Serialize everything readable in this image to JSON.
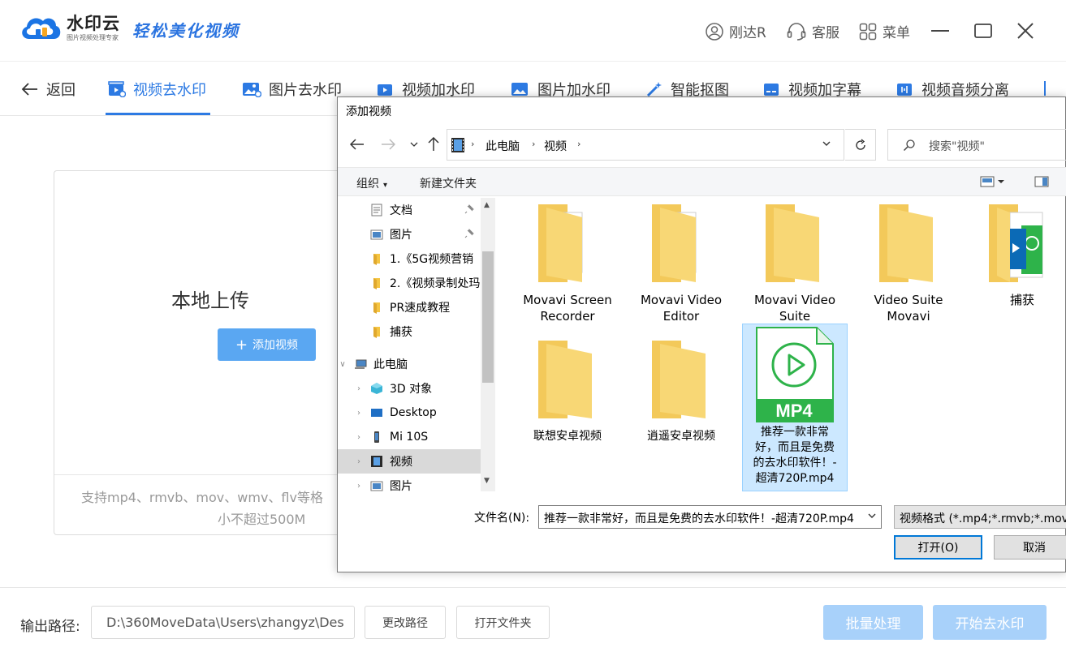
{
  "header": {
    "logo_name": "水印云",
    "logo_sub": "图片视频处理专家",
    "slogan": "轻松美化视频",
    "user": "刚达R",
    "service": "客服",
    "menu": "菜单"
  },
  "nav": {
    "back": "返回",
    "tabs": [
      {
        "label": "视频去水印",
        "active": true
      },
      {
        "label": "图片去水印"
      },
      {
        "label": "视频加水印"
      },
      {
        "label": "图片加水印"
      },
      {
        "label": "智能抠图"
      },
      {
        "label": "视频加字幕"
      },
      {
        "label": "视频音频分离"
      }
    ]
  },
  "upload": {
    "title": "本地上传",
    "add_button": "添加视频",
    "hint_line1": "支持mp4、rmvb、mov、wmv、flv等格",
    "hint_line2": "小不超过500M"
  },
  "footer": {
    "output_label": "输出路径:",
    "output_path": "D:\\360MoveData\\Users\\zhangyz\\Des",
    "change_path": "更改路径",
    "open_folder": "打开文件夹",
    "batch": "批量处理",
    "start": "开始去水印"
  },
  "dialog": {
    "title": "添加视频",
    "breadcrumb": [
      "此电脑",
      "视频"
    ],
    "search_placeholder": "搜索\"视频\"",
    "toolbar": {
      "organize": "组织",
      "new_folder": "新建文件夹"
    },
    "nav_items": [
      {
        "label": "文档",
        "icon": "document-icon",
        "pinned": true
      },
      {
        "label": "图片",
        "icon": "pictures-icon",
        "pinned": true
      },
      {
        "label": "1.《5G视频营销",
        "icon": "folder-icon"
      },
      {
        "label": "2.《视频录制处玛",
        "icon": "folder-icon"
      },
      {
        "label": "PR速成教程",
        "icon": "folder-icon"
      },
      {
        "label": "捕获",
        "icon": "folder-icon"
      },
      {
        "label": "此电脑",
        "icon": "computer-icon",
        "expanded": true
      },
      {
        "label": "3D 对象",
        "icon": "3d-objects-icon"
      },
      {
        "label": "Desktop",
        "icon": "desktop-icon"
      },
      {
        "label": "Mi 10S",
        "icon": "phone-icon"
      },
      {
        "label": "视频",
        "icon": "video-folder-icon",
        "selected": true
      },
      {
        "label": "图片",
        "icon": "pictures-icon"
      }
    ],
    "files": [
      {
        "name": "Movavi Screen\nRecorder",
        "type": "folder-docs"
      },
      {
        "name": "Movavi Video\nEditor",
        "type": "folder-docs"
      },
      {
        "name": "Movavi Video\nSuite",
        "type": "folder"
      },
      {
        "name": "Video Suite\nMovavi",
        "type": "folder"
      },
      {
        "name": "捕获",
        "type": "folder-media"
      },
      {
        "name": "联想安卓视频",
        "type": "folder"
      },
      {
        "name": "逍遥安卓视频",
        "type": "folder"
      },
      {
        "name": "推荐一款非常\n好，而且是免费\n的去水印软件！-\n超清720P.mp4",
        "type": "mp4",
        "selected": true
      }
    ],
    "mp4_badge": "MP4",
    "filename_label": "文件名(N):",
    "filename_value": "推荐一款非常好，而且是免费的去水印软件！-超清720P.mp4",
    "filetype": "视频格式 (*.mp4;*.rmvb;*.mov",
    "open": "打开(O)",
    "cancel": "取消"
  },
  "colors": {
    "accent": "#2d7ae3",
    "button_light": "#a8d1fa",
    "add_button": "#5aa7f2",
    "folder": "#f8d775"
  }
}
